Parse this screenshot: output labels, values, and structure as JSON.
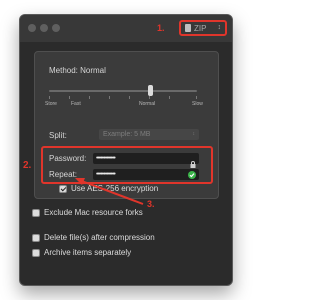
{
  "steps": {
    "one": "1.",
    "two": "2.",
    "three": "3."
  },
  "format": {
    "value": "ZIP"
  },
  "method": {
    "label": "Method: Normal",
    "ticks": [
      "Store",
      "Fast",
      "Normal",
      "Slow"
    ]
  },
  "split": {
    "label": "Split:",
    "value": "Example: 5 MB"
  },
  "password": {
    "label": "Password:",
    "dots": "•••••••••••••"
  },
  "repeat": {
    "label": "Repeat:",
    "dots": "•••••••••••••"
  },
  "encryption": {
    "label": "Use AES-256 encryption",
    "checked": true
  },
  "options": [
    {
      "label": "Exclude Mac resource forks",
      "checked": false
    },
    {
      "label": "Delete file(s) after compression",
      "checked": false
    },
    {
      "label": "Archive items separately",
      "checked": false
    }
  ],
  "colors": {
    "annotation": "#e0352b",
    "window_bg": "#2b2b2b",
    "success": "#3bb54a"
  }
}
